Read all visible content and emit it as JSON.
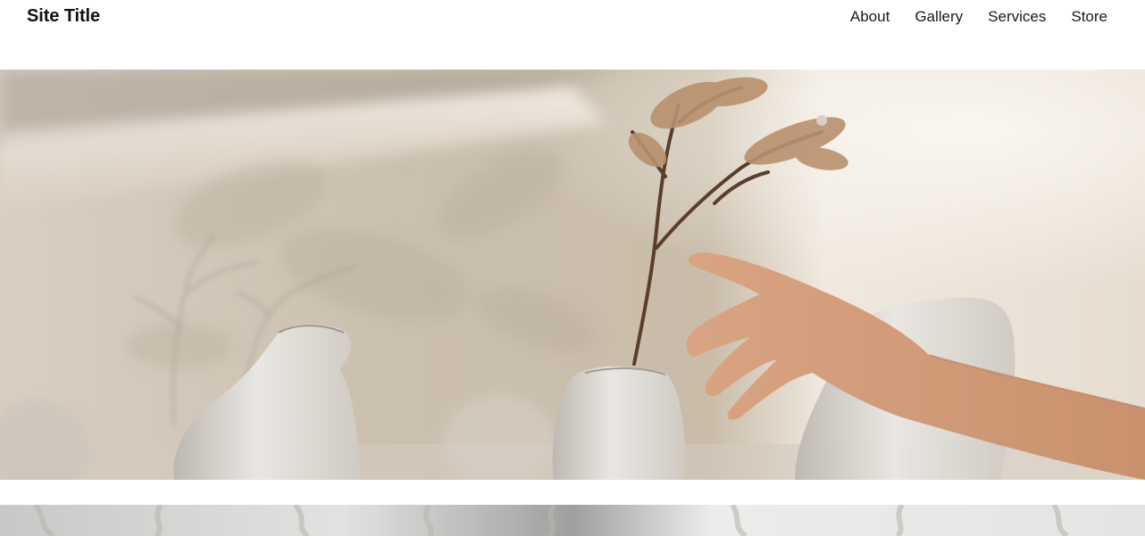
{
  "header": {
    "site_title": "Site Title",
    "nav": [
      {
        "label": "About"
      },
      {
        "label": "Gallery"
      },
      {
        "label": "Services"
      },
      {
        "label": "Store"
      }
    ]
  },
  "colors": {
    "background": "#ffffff",
    "text": "#111111",
    "hero_wall": "#d8ccbb",
    "vase": "#e4e1dc"
  },
  "images": {
    "hero": "photo-dried-flowers-vases-hand",
    "second": "photo-white-fabric"
  }
}
